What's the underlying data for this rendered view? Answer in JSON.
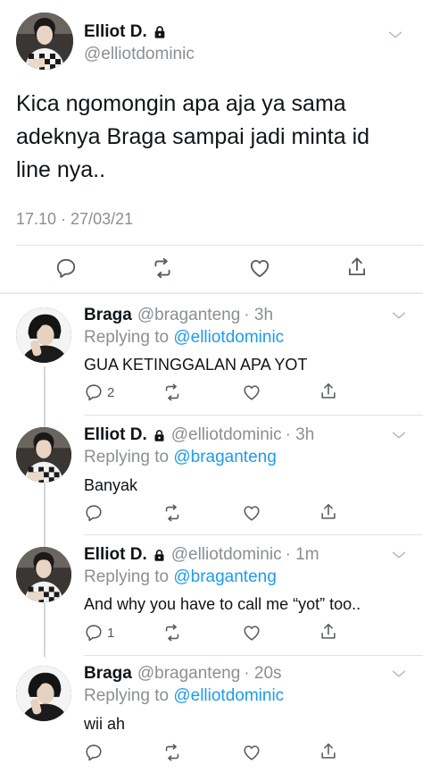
{
  "main_tweet": {
    "name": "Elliot D.",
    "handle": "@elliotdominic",
    "text_lines": [
      "Kica ngomongin apa aja ya sama",
      "adeknya Braga sampai jadi minta id",
      "line nya.."
    ],
    "timestamp": "17.10 · 27/03/21"
  },
  "replies": [
    {
      "name": "Braga",
      "handle": "@braganteng",
      "time": "· 3h",
      "replying_prefix": "Replying to",
      "replying_to": "@elliotdominic",
      "text": "GUA KETINGGALAN APA YOT",
      "reply_count": "2",
      "locked": false
    },
    {
      "name": "Elliot D.",
      "handle": "@elliotdominic",
      "time": "· 3h",
      "replying_prefix": "Replying to",
      "replying_to": "@braganteng",
      "text": "Banyak",
      "reply_count": "",
      "locked": true
    },
    {
      "name": "Elliot D.",
      "handle": "@elliotdominic",
      "time": "· 1m",
      "replying_prefix": "Replying to",
      "replying_to": "@braganteng",
      "text": "And why you have to call me “yot” too..",
      "reply_count": "1",
      "locked": true
    },
    {
      "name": "Braga",
      "handle": "@braganteng",
      "time": "· 20s",
      "replying_prefix": "Replying to",
      "replying_to": "@elliotdominic",
      "text": "wii ah",
      "reply_count": "",
      "locked": false
    }
  ],
  "icons": {
    "reply": "reply-icon",
    "retweet": "retweet-icon",
    "like": "like-icon",
    "share": "share-icon",
    "lock": "lock-icon",
    "more": "chevron-down-icon"
  },
  "colors": {
    "link": "#1d9bf0",
    "secondary_text": "#8a8f94",
    "divider": "#e1e4e7"
  }
}
